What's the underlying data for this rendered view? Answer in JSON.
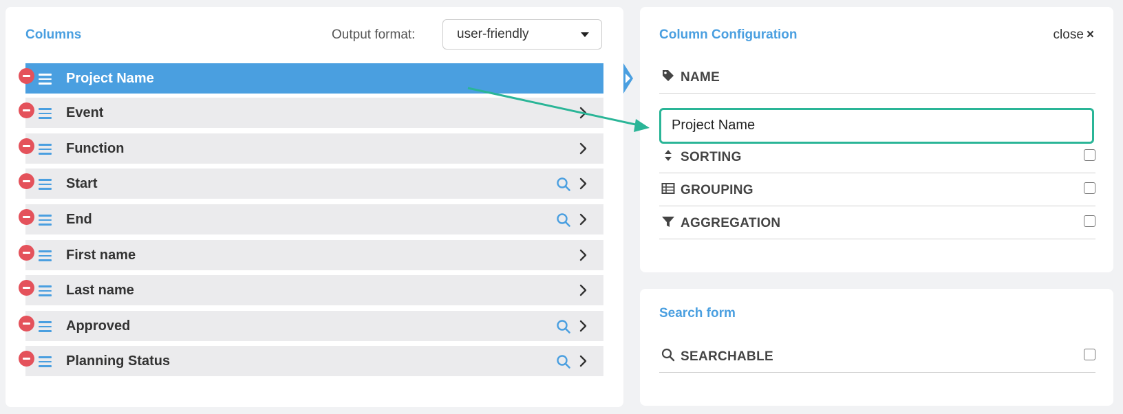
{
  "columns_panel": {
    "title": "Columns",
    "output_format_label": "Output format:",
    "output_format_value": "user-friendly",
    "rows": [
      {
        "label": "Project Name",
        "selected": true,
        "searchable": false
      },
      {
        "label": "Event",
        "selected": false,
        "searchable": false
      },
      {
        "label": "Function",
        "selected": false,
        "searchable": false
      },
      {
        "label": "Start",
        "selected": false,
        "searchable": true
      },
      {
        "label": "End",
        "selected": false,
        "searchable": true
      },
      {
        "label": "First name",
        "selected": false,
        "searchable": false
      },
      {
        "label": "Last name",
        "selected": false,
        "searchable": false
      },
      {
        "label": "Approved",
        "selected": false,
        "searchable": true
      },
      {
        "label": "Planning Status",
        "selected": false,
        "searchable": true
      }
    ]
  },
  "config_panel": {
    "title": "Column Configuration",
    "close_label": "close",
    "close_icon": "×",
    "name_label": "NAME",
    "name_value": "Project Name",
    "sorting_label": "SORTING",
    "grouping_label": "GROUPING",
    "aggregation_label": "AGGREGATION",
    "sorting_checked": false,
    "grouping_checked": false,
    "aggregation_checked": false
  },
  "search_panel": {
    "title": "Search form",
    "searchable_label": "SEARCHABLE",
    "searchable_checked": false
  },
  "colors": {
    "accent": "#4a9fe0",
    "row_bg": "#ebebed",
    "remove": "#e4525b",
    "highlight": "#2ab597"
  }
}
